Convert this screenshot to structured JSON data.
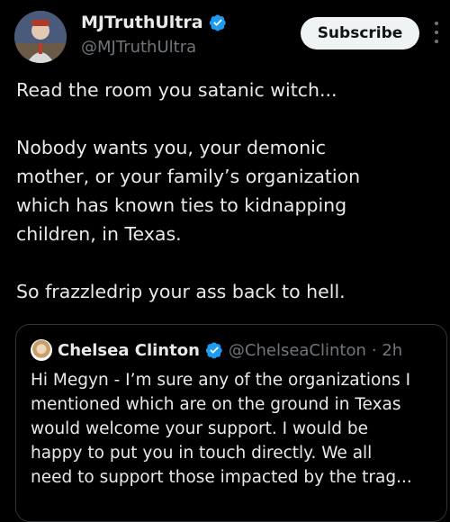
{
  "tweet": {
    "display_name": "MJTruthUltra",
    "handle": "@MJTruthUltra",
    "subscribe_label": "Subscribe",
    "lines": [
      "Read the room you satanic witch...",
      "",
      "Nobody wants you, your demonic",
      "mother, or your family’s organization",
      "which has known ties to kidnapping",
      "children, in Texas.",
      "",
      "So frazzledrip your ass back to hell."
    ]
  },
  "quote": {
    "display_name": "Chelsea Clinton",
    "handle": "@ChelseaClinton",
    "time": "· 2h",
    "lines": [
      "Hi Megyn - I’m sure any of the organizations I",
      "mentioned which are on the ground in Texas",
      "would welcome your support. I would be",
      "happy to put you in touch directly. We all",
      "need to support those impacted by the trag..."
    ]
  },
  "colors": {
    "background": "#000000",
    "text": "#e7e9ea",
    "muted": "#71767b",
    "verified": "#1d9bf0",
    "border": "#2f3336"
  }
}
